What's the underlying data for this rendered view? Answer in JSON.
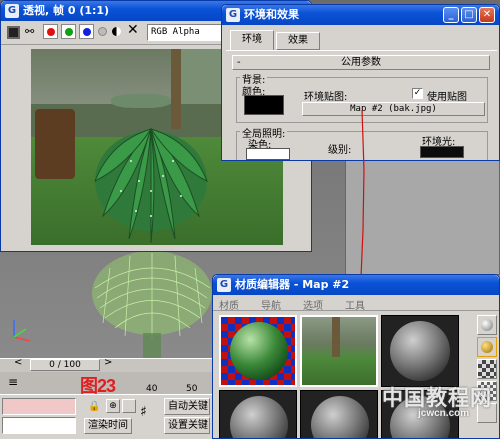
{
  "viewport": {
    "title": "透视, 帧 0 (1:1)",
    "render_channel": "RGB Alpha"
  },
  "env_dialog": {
    "title": "环境和效果",
    "tabs": [
      "环境",
      "效果"
    ],
    "rollout": "公用参数",
    "background_group": "背景:",
    "color_label": "颜色:",
    "env_map_label": "环境贴图:",
    "use_map_label": "使用贴图",
    "use_map_checked": true,
    "map_button": "Map #2 (bak.jpg)",
    "global_lighting": "全局照明:",
    "tint_label": "染色:",
    "level_label": "级别:",
    "ambient_label": "环境光:"
  },
  "material_editor": {
    "title": "材质编辑器 - Map #2",
    "menu": [
      "材质",
      "导航",
      "选项",
      "工具"
    ]
  },
  "timeline": {
    "frame_display": "0 / 100",
    "tick_labels": [
      "40",
      "50"
    ],
    "figure_label": "图23"
  },
  "bottom_bar": {
    "render_time": "渲染时间",
    "auto_key": "自动关键",
    "set_key": "设置关键"
  },
  "watermark": {
    "cn": "中国教程网",
    "url": "jcwcn.com"
  },
  "colors": {
    "xp_title_blue": "#0a52d8",
    "panel_gray": "#d6d3ce",
    "figure_label_red": "#e02020",
    "connector_red": "#d01010"
  }
}
